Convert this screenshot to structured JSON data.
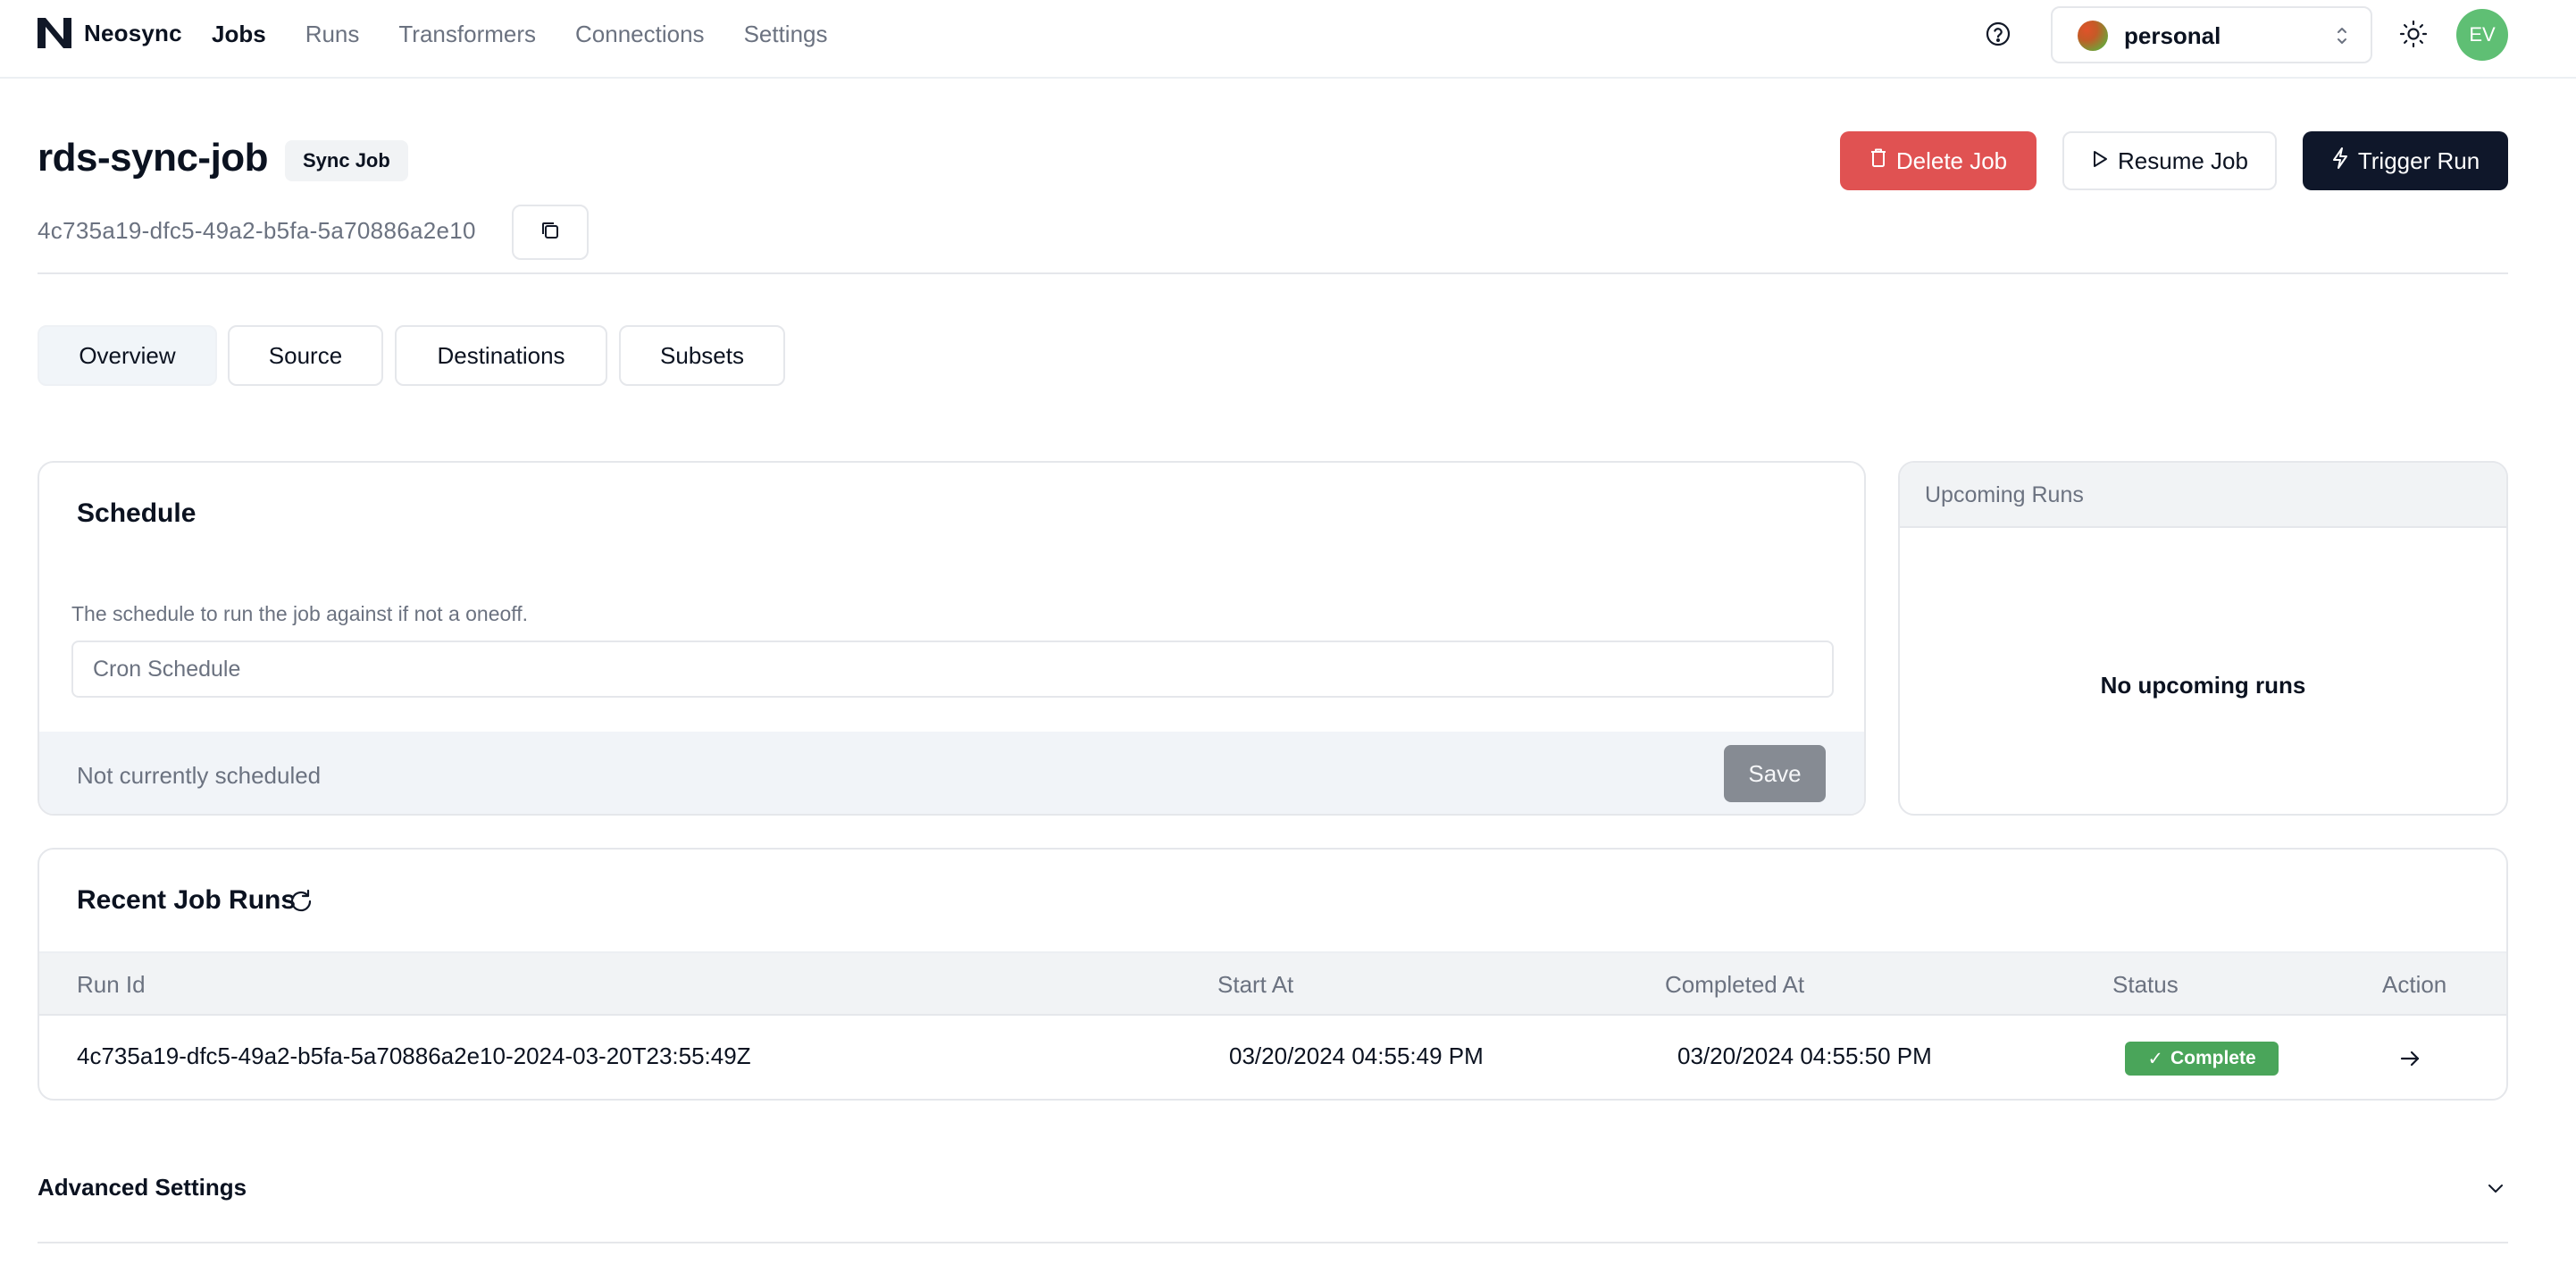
{
  "app": {
    "name": "Neosync"
  },
  "nav": {
    "items": [
      {
        "label": "Jobs",
        "active": true
      },
      {
        "label": "Runs",
        "active": false
      },
      {
        "label": "Transformers",
        "active": false
      },
      {
        "label": "Connections",
        "active": false
      },
      {
        "label": "Settings",
        "active": false
      }
    ]
  },
  "account": {
    "name": "personal"
  },
  "user": {
    "initials": "EV"
  },
  "job": {
    "name": "rds-sync-job",
    "type_badge": "Sync Job",
    "id": "4c735a19-dfc5-49a2-b5fa-5a70886a2e10"
  },
  "actions": {
    "delete_label": "Delete Job",
    "resume_label": "Resume Job",
    "trigger_label": "Trigger Run"
  },
  "tabs": [
    {
      "label": "Overview",
      "active": true
    },
    {
      "label": "Source",
      "active": false
    },
    {
      "label": "Destinations",
      "active": false
    },
    {
      "label": "Subsets",
      "active": false
    }
  ],
  "schedule": {
    "title": "Schedule",
    "description": "The schedule to run the job against if not a oneoff.",
    "placeholder": "Cron Schedule",
    "value": "",
    "status": "Not currently scheduled",
    "save_label": "Save"
  },
  "upcoming": {
    "title": "Upcoming Runs",
    "empty_text": "No upcoming runs"
  },
  "recent_runs": {
    "title": "Recent Job Runs",
    "columns": [
      "Run Id",
      "Start At",
      "Completed At",
      "Status",
      "Action"
    ],
    "rows": [
      {
        "run_id": "4c735a19-dfc5-49a2-b5fa-5a70886a2e10-2024-03-20T23:55:49Z",
        "start_at": "03/20/2024 04:55:49 PM",
        "completed_at": "03/20/2024 04:55:50 PM",
        "status": "Complete"
      }
    ]
  },
  "advanced": {
    "label": "Advanced Settings"
  },
  "colors": {
    "danger": "#e05252",
    "primary": "#0f172a",
    "success": "#4aa55a",
    "avatar": "#5fbf74"
  },
  "icons": {
    "logo": "neosync-logo-icon",
    "help": "help-circle-icon",
    "chevrons": "chevrons-up-down-icon",
    "theme": "sun-icon",
    "copy": "copy-icon",
    "delete": "trash-icon",
    "resume": "play-icon",
    "trigger": "lightning-icon",
    "refresh": "refresh-icon",
    "action": "arrow-right-icon",
    "expand": "chevron-down-icon"
  }
}
